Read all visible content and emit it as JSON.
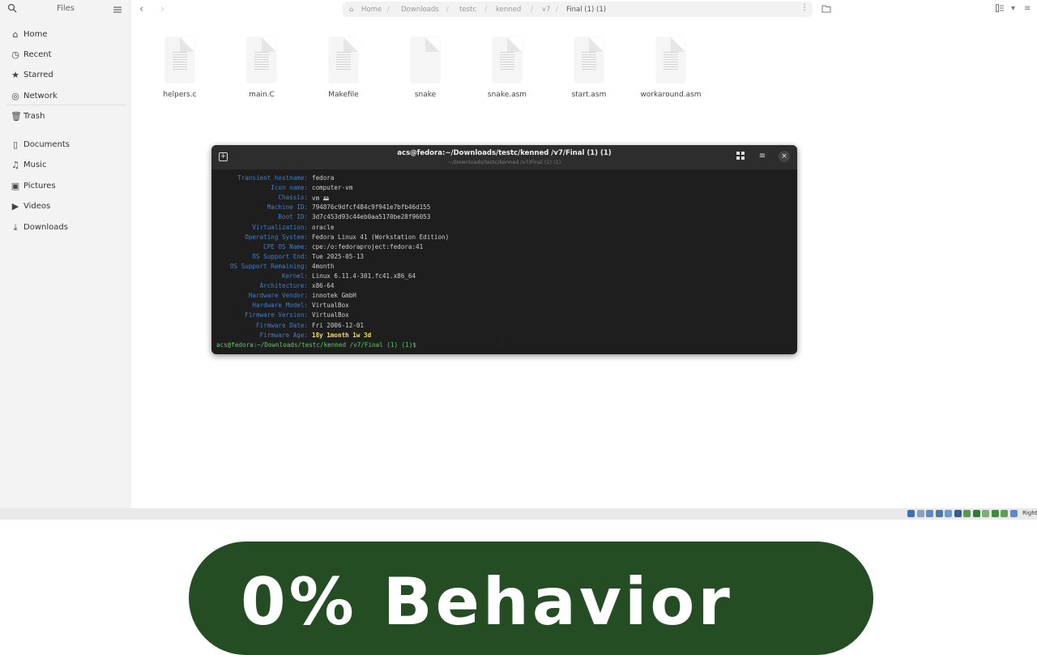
{
  "sidebar": {
    "title": "Files",
    "items": [
      {
        "label": "Home",
        "icon": "home-icon",
        "glyph": "⌂"
      },
      {
        "label": "Recent",
        "icon": "clock-icon",
        "glyph": "◷"
      },
      {
        "label": "Starred",
        "icon": "star-icon",
        "glyph": "★"
      },
      {
        "label": "Network",
        "icon": "network-icon",
        "glyph": "◎"
      },
      {
        "label": "Trash",
        "icon": "trash-icon",
        "glyph": "🗑"
      },
      {
        "label": "Documents",
        "icon": "document-icon",
        "glyph": "▯"
      },
      {
        "label": "Music",
        "icon": "music-icon",
        "glyph": "♫"
      },
      {
        "label": "Pictures",
        "icon": "picture-icon",
        "glyph": "▣"
      },
      {
        "label": "Videos",
        "icon": "video-icon",
        "glyph": "▶"
      },
      {
        "label": "Downloads",
        "icon": "download-icon",
        "glyph": "⤓"
      }
    ]
  },
  "pathbar": {
    "crumbs": [
      "Home",
      "Downloads",
      "testc",
      "kenned",
      "v7",
      "Final (1) (1)"
    ],
    "separator": "/"
  },
  "files": [
    {
      "name": "helpers.c",
      "icon": "c-source-file-icon"
    },
    {
      "name": "main.C",
      "icon": "c-source-file-icon"
    },
    {
      "name": "Makefile",
      "icon": "text-file-icon"
    },
    {
      "name": "snake",
      "icon": "binary-file-icon"
    },
    {
      "name": "snake.asm",
      "icon": "asm-file-icon"
    },
    {
      "name": "start.asm",
      "icon": "asm-file-icon"
    },
    {
      "name": "workaround.asm",
      "icon": "asm-file-icon"
    }
  ],
  "terminal": {
    "title": "acs@fedora:~/Downloads/testc/kenned /v7/Final (1) (1)",
    "subtitle": "~/Downloads/testc/kenned /v7/Final (1) (1)",
    "close_glyph": "×",
    "lines": [
      {
        "key": "Transient hostname:",
        "value": "fedora"
      },
      {
        "key": "Icon name:",
        "value": "computer-vm"
      },
      {
        "key": "Chassis:",
        "value": "vm 🖴"
      },
      {
        "key": "Machine ID:",
        "value": "794876c9dfcf484c9f941e7bfb46d155"
      },
      {
        "key": "Boot ID:",
        "value": "3d7c453d93c44eb0aa5170be28f96053"
      },
      {
        "key": "Virtualization:",
        "value": "oracle"
      },
      {
        "key": "Operating System:",
        "value": "Fedora Linux 41 (Workstation Edition)"
      },
      {
        "key": "CPE OS Name:",
        "value": "cpe:/o:fedoraproject:fedora:41"
      },
      {
        "key": "OS Support End:",
        "value": "Tue 2025-05-13"
      },
      {
        "key": "OS Support Remaining:",
        "value": "4month"
      },
      {
        "key": "Kernel:",
        "value": "Linux 6.11.4-301.fc41.x86_64"
      },
      {
        "key": "Architecture:",
        "value": "x86-64"
      },
      {
        "key": "Hardware Vendor:",
        "value": "innotek GmbH"
      },
      {
        "key": "Hardware Model:",
        "value": "VirtualBox"
      },
      {
        "key": "Firmware Version:",
        "value": "VirtualBox"
      },
      {
        "key": "Firmware Date:",
        "value": "Fri 2006-12-01"
      },
      {
        "key": "Firmware Age:",
        "value": "18y 1month 1w 3d",
        "highlight": true
      }
    ],
    "prompt": "acs@fedora:~/Downloads/testc/kenned /v7/Final (1) (1)$"
  },
  "vbox": {
    "host_key": "Right",
    "indicator_colors": [
      "#3b6fb6",
      "#8aa0c0",
      "#5a8ac8",
      "#4a7ab0",
      "#6a9ad0",
      "#3a5a90",
      "#4f9f4f",
      "#2e7d32",
      "#7ab07a",
      "#3c8c3c",
      "#5aa05a",
      "#5a8ac8"
    ]
  },
  "overlay": {
    "text": "0% Behavior",
    "color": "#244d24"
  }
}
